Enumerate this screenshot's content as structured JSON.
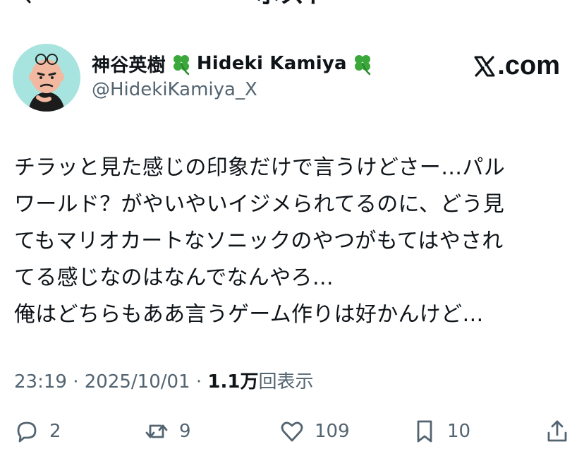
{
  "header": {
    "title": "ポスト"
  },
  "author": {
    "display_name_jp": "神谷英樹",
    "display_name_en": "Hideki Kamiya",
    "handle": "@HidekiKamiya_X"
  },
  "brand": {
    "mark": "X",
    "suffix": ".com"
  },
  "post": {
    "lines": [
      "チラッと見た感じの印象だけで言うけどさー…パル",
      "ワールド？がやいやいイジメられてるのに、どう見",
      "てもマリオカートなソニックのやつがもてはやされ",
      "てる感じなのはなんでなんやろ…",
      "俺はどちらもああ言うゲーム作りは好かんけど…"
    ],
    "time": "23:19",
    "separator": "·",
    "date": "2025/10/01",
    "views_count": "1.1万",
    "views_label": "回表示"
  },
  "actions": {
    "replies": "2",
    "reposts": "9",
    "likes": "109",
    "bookmarks": "10"
  },
  "icons": [
    "back-arrow-icon",
    "clover-icon",
    "x-logo-icon",
    "reply-icon",
    "repost-icon",
    "like-icon",
    "bookmark-icon",
    "share-icon"
  ],
  "colors": {
    "text": "#0f1419",
    "secondary": "#536471",
    "avatar_bg": "#a7e3df",
    "clover": "#3aa83a"
  }
}
